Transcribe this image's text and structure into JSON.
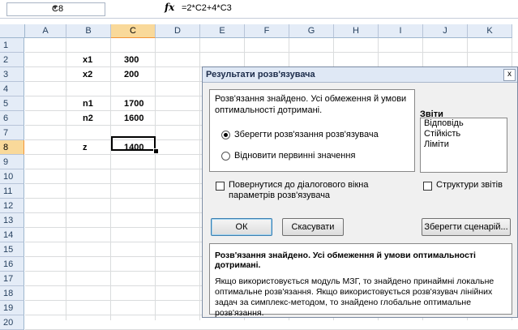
{
  "formula_bar": {
    "name_box": "C8",
    "fx_label": "fx",
    "formula": "=2*C2+4*C3"
  },
  "columns": [
    "A",
    "B",
    "C",
    "D",
    "E",
    "F",
    "G",
    "H",
    "I",
    "J",
    "K"
  ],
  "selected_column": "C",
  "rows": [
    "1",
    "2",
    "3",
    "4",
    "5",
    "6",
    "7",
    "8",
    "9",
    "10",
    "11",
    "12",
    "13",
    "14",
    "15",
    "16",
    "17",
    "18",
    "19",
    "20"
  ],
  "selected_row": "8",
  "cells": {
    "B2": "x1",
    "C2": "300",
    "B3": "x2",
    "C3": "200",
    "B5": "n1",
    "C5": "1700",
    "B6": "n2",
    "C6": "1600",
    "B8": "z",
    "C8": "1400"
  },
  "dialog": {
    "title": "Результати розв'язувача",
    "close": "x",
    "message": "Розв'язання знайдено. Усі обмеження й умови оптимальності дотримані.",
    "keep_solution": "Зберегти розв'язання розв'язувача",
    "restore_values": "Відновити первинні значення",
    "reports_label": "Звіти",
    "reports": [
      "Відповідь",
      "Стійкість",
      "Ліміти"
    ],
    "return_to_params": "Повернутися до діалогового вікна параметрів розв'язувача",
    "outline_reports": "Структури звітів",
    "ok": "ОК",
    "cancel": "Скасувати",
    "save_scenario": "Зберегти сценарій...",
    "info_title": "Розв'язання знайдено. Усі обмеження й умови оптимальності дотримані.",
    "info_body": "Якщо використовується модуль МЗГ, то знайдено принаймні локальне оптимальне розв'язання. Якщо використовується розв'язувач лінійних задач за симплекс-методом, то знайдено глобальне оптимальне розв'язання."
  }
}
